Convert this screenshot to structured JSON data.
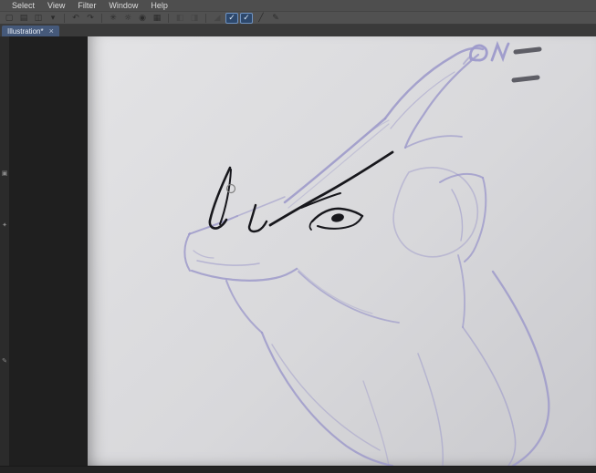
{
  "menu": {
    "items": [
      "Select",
      "View",
      "Filter",
      "Window",
      "Help"
    ]
  },
  "toolbar": {
    "buttons": [
      {
        "name": "new",
        "glyph": "▢"
      },
      {
        "name": "open",
        "glyph": "▤"
      },
      {
        "name": "save",
        "glyph": "◫"
      },
      {
        "name": "dropdown",
        "glyph": "▾"
      },
      {
        "name": "undo",
        "glyph": "↶"
      },
      {
        "name": "redo",
        "glyph": "↷"
      },
      {
        "name": "rotate",
        "glyph": "✳"
      },
      {
        "name": "brightness",
        "glyph": "☼"
      },
      {
        "name": "color-lamp",
        "glyph": "◉"
      },
      {
        "name": "grid",
        "glyph": "▦"
      },
      {
        "name": "snap-a",
        "glyph": "◧",
        "state": "disabled"
      },
      {
        "name": "snap-b",
        "glyph": "◨",
        "state": "disabled"
      },
      {
        "name": "gradient",
        "glyph": "◢",
        "state": "disabled"
      },
      {
        "name": "check-a",
        "glyph": "✓",
        "state": "active"
      },
      {
        "name": "check-b",
        "glyph": "✓",
        "state": "active"
      },
      {
        "name": "line-tool",
        "glyph": "╱"
      },
      {
        "name": "brush-tool",
        "glyph": "✎"
      }
    ]
  },
  "tab_bar": {
    "tabs": [
      {
        "label": "Illustration*",
        "close_glyph": "×",
        "active": true
      }
    ]
  },
  "side_rail": {
    "icons": [
      {
        "glyph": "▣"
      },
      {
        "glyph": "✦"
      },
      {
        "glyph": "✎"
      }
    ]
  },
  "colors": {
    "sketch_lavender": "#9d9aca",
    "ink_black": "#17171c",
    "scribble_gray": "#5e5e66",
    "toolbar_active": "#2d486c"
  }
}
